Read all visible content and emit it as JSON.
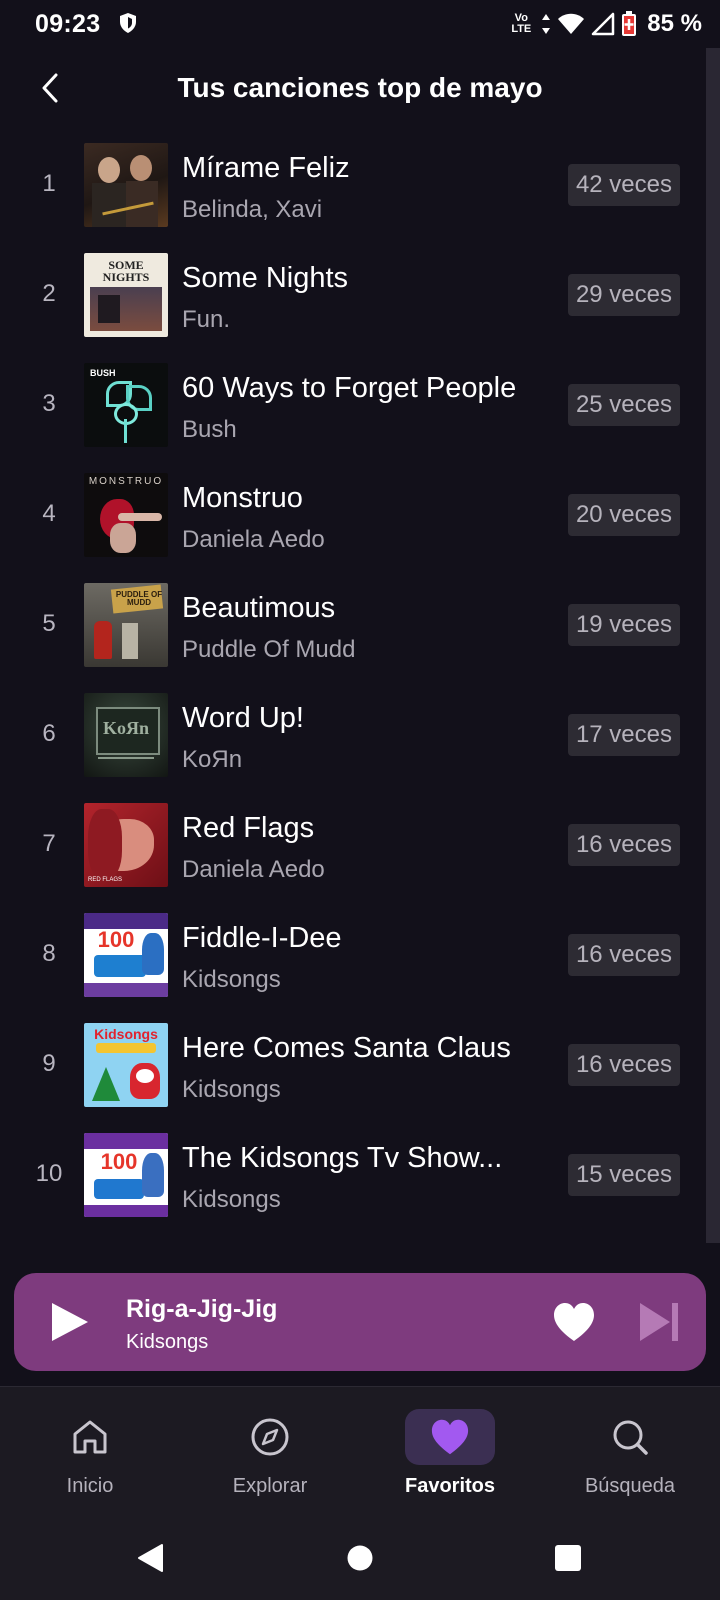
{
  "status_bar": {
    "time": "09:23",
    "network_label_top": "Vo",
    "network_label_bottom": "LTE",
    "battery_text": "85 %",
    "icons": [
      "shield-icon",
      "volte-icon",
      "data-arrows-icon",
      "wifi-icon",
      "cell-signal-icon",
      "battery-icon"
    ]
  },
  "header": {
    "title": "Tus canciones top de mayo",
    "back_icon": "chevron-left-icon"
  },
  "songs": [
    {
      "rank": "1",
      "title": "Mírame Feliz",
      "artist": "Belinda, Xavi",
      "count": "42 veces",
      "cover_text": ""
    },
    {
      "rank": "2",
      "title": "Some Nights",
      "artist": "Fun.",
      "count": "29 veces",
      "cover_text": "SOME NIGHTS"
    },
    {
      "rank": "3",
      "title": "60 Ways to Forget People",
      "artist": "Bush",
      "count": "25 veces",
      "cover_text": "BUSH"
    },
    {
      "rank": "4",
      "title": "Monstruo",
      "artist": "Daniela Aedo",
      "count": "20 veces",
      "cover_text": "MONSTRUO"
    },
    {
      "rank": "5",
      "title": "Beautimous",
      "artist": "Puddle Of Mudd",
      "count": "19 veces",
      "cover_text": "PUDDLE OF MUDD"
    },
    {
      "rank": "6",
      "title": "Word Up!",
      "artist": "KoЯn",
      "count": "17 veces",
      "cover_text": "KoЯn"
    },
    {
      "rank": "7",
      "title": "Red Flags",
      "artist": "Daniela Aedo",
      "count": "16 veces",
      "cover_text": "RED FLAGS"
    },
    {
      "rank": "8",
      "title": "Fiddle-I-Dee",
      "artist": "Kidsongs",
      "count": "16 veces",
      "cover_text": "100"
    },
    {
      "rank": "9",
      "title": "Here Comes Santa Claus",
      "artist": "Kidsongs",
      "count": "16 veces",
      "cover_text": "Kidsongs"
    },
    {
      "rank": "10",
      "title": "The Kidsongs Tv Show...",
      "artist": "Kidsongs",
      "count": "15 veces",
      "cover_text": "100"
    }
  ],
  "player": {
    "title": "Rig-a-Jig-Jig",
    "artist": "Kidsongs",
    "icons": [
      "play-icon",
      "heart-icon",
      "skip-next-icon"
    ]
  },
  "bottom_nav": {
    "active": "Favoritos",
    "items": [
      {
        "label": "Inicio",
        "icon": "home-icon"
      },
      {
        "label": "Explorar",
        "icon": "compass-icon"
      },
      {
        "label": "Favoritos",
        "icon": "heart-icon"
      },
      {
        "label": "Búsqueda",
        "icon": "search-icon"
      }
    ]
  },
  "colors": {
    "background": "#12101a",
    "player": "#7e3b7e",
    "accent": "#a259f0",
    "badge": "#2d2b33"
  }
}
